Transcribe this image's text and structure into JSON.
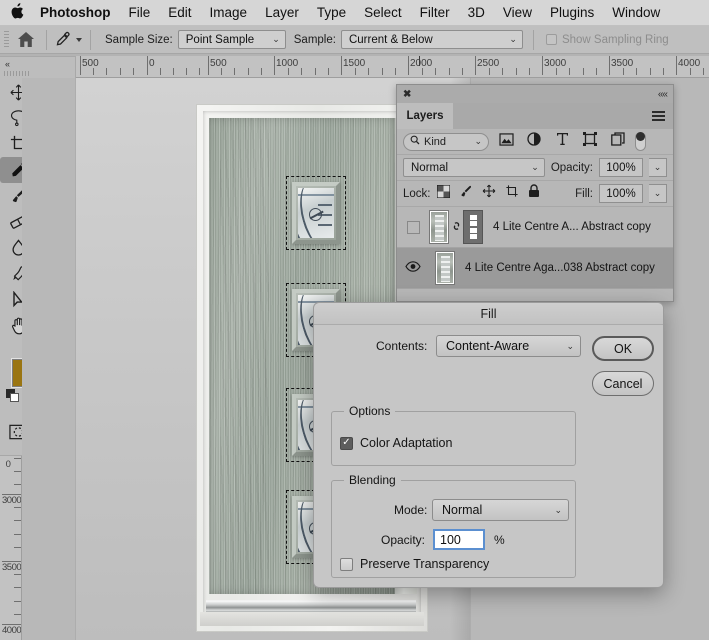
{
  "menubar": {
    "apple_icon": "apple-logo-icon",
    "items": [
      {
        "label": "Photoshop",
        "bold": true
      },
      {
        "label": "File"
      },
      {
        "label": "Edit"
      },
      {
        "label": "Image"
      },
      {
        "label": "Layer"
      },
      {
        "label": "Type"
      },
      {
        "label": "Select"
      },
      {
        "label": "Filter"
      },
      {
        "label": "3D"
      },
      {
        "label": "View"
      },
      {
        "label": "Plugins"
      },
      {
        "label": "Window"
      }
    ]
  },
  "options_bar": {
    "home_icon": "home-icon",
    "tool_icon": "eyedropper-icon",
    "sample_size_label": "Sample Size:",
    "sample_size_value": "Point Sample",
    "sample_label": "Sample:",
    "sample_value": "Current & Below",
    "show_sampling_ring_label": "Show Sampling Ring",
    "show_sampling_ring_checked": false,
    "show_sampling_ring_enabled": false
  },
  "toolbar": {
    "collapse_icon": "double-chevron-left-icon",
    "tools": [
      {
        "name": "move-tool",
        "icon": "move-icon"
      },
      {
        "name": "rectangular-marquee-tool",
        "icon": "marquee-icon"
      },
      {
        "name": "lasso-tool",
        "icon": "lasso-icon"
      },
      {
        "name": "object-selection-tool",
        "icon": "magic-wand-icon"
      },
      {
        "name": "crop-tool",
        "icon": "crop-icon"
      },
      {
        "name": "frame-tool",
        "icon": "frame-icon"
      },
      {
        "name": "eyedropper-tool",
        "icon": "eyedropper-icon",
        "selected": true
      },
      {
        "name": "healing-brush-tool",
        "icon": "healing-brush-icon"
      },
      {
        "name": "brush-tool",
        "icon": "brush-icon"
      },
      {
        "name": "clone-stamp-tool",
        "icon": "clone-stamp-icon"
      },
      {
        "name": "eraser-tool",
        "icon": "eraser-icon"
      },
      {
        "name": "gradient-tool",
        "icon": "gradient-icon"
      },
      {
        "name": "blur-tool",
        "icon": "blur-drop-icon"
      },
      {
        "name": "dodge-tool",
        "icon": "dodge-icon"
      },
      {
        "name": "pen-tool",
        "icon": "pen-icon"
      },
      {
        "name": "type-tool",
        "icon": "type-t-icon"
      },
      {
        "name": "path-selection-tool",
        "icon": "path-arrow-icon"
      },
      {
        "name": "rectangle-tool",
        "icon": "rectangle-shape-icon"
      },
      {
        "name": "hand-tool",
        "icon": "hand-icon"
      },
      {
        "name": "zoom-tool",
        "icon": "magnifier-icon"
      }
    ],
    "more_tools_icon": "ellipsis-icon",
    "foreground_color": "#9a7512",
    "background_color": "#ffffff",
    "swap_colors_icon": "swap-arrows-icon",
    "default_colors_icon": "default-colors-icon",
    "quick_mask_icon": "quick-mask-icon",
    "screen_mode_icon": "screen-mode-icon"
  },
  "rulers": {
    "unit_hint": "px",
    "top_ticks": [
      "500",
      "0",
      "500",
      "1000",
      "1500",
      "2000",
      "2500",
      "3000",
      "3500",
      "4000"
    ],
    "left_ticks": [
      "0",
      "3000",
      "3500",
      "4000"
    ]
  },
  "layers_panel": {
    "close_icon": "close-icon",
    "collapse_icon": "double-chevron-right-icon",
    "tab_label": "Layers",
    "menu_icon": "panel-menu-icon",
    "filter": {
      "search_icon": "search-icon",
      "kind_label": "Kind",
      "icons": [
        {
          "name": "filter-pixel-icon"
        },
        {
          "name": "filter-adjustment-icon"
        },
        {
          "name": "filter-type-icon"
        },
        {
          "name": "filter-shape-icon"
        },
        {
          "name": "filter-smart-object-icon"
        }
      ],
      "toggle_name": "filter-toggle-switch"
    },
    "blend_mode": "Normal",
    "opacity_label": "Opacity:",
    "opacity_value": "100%",
    "lock_label": "Lock:",
    "lock_icons": [
      {
        "name": "lock-transparent-pixels-icon"
      },
      {
        "name": "lock-image-pixels-icon"
      },
      {
        "name": "lock-position-icon"
      },
      {
        "name": "lock-artboard-nesting-icon"
      },
      {
        "name": "lock-all-icon"
      }
    ],
    "fill_label": "Fill:",
    "fill_value": "100%",
    "layers": [
      {
        "name": "4 Lite Centre A... Abstract copy",
        "visible": false,
        "selected": false,
        "has_mask": true,
        "linked": true
      },
      {
        "name": "4 Lite Centre Aga...038 Abstract copy",
        "visible": true,
        "selected": true,
        "has_mask": false,
        "linked": false
      }
    ]
  },
  "fill_dialog": {
    "title": "Fill",
    "contents_label": "Contents:",
    "contents_value": "Content-Aware",
    "ok_label": "OK",
    "cancel_label": "Cancel",
    "options_group_title": "Options",
    "color_adaptation_label": "Color Adaptation",
    "color_adaptation_checked": true,
    "blending_group_title": "Blending",
    "mode_label": "Mode:",
    "mode_value": "Normal",
    "opacity_label": "Opacity:",
    "opacity_value": "100",
    "percent_symbol": "%",
    "preserve_transparency_label": "Preserve Transparency",
    "preserve_transparency_checked": false
  },
  "canvas": {
    "document_name": "composite-door-document",
    "selection_count": 4,
    "selection_label": "marching-ants-selection"
  },
  "colors": {
    "menubar_bg": "#d6d6d6",
    "panel_bg": "#b7b7b7",
    "dialog_bg": "#c6c6c6",
    "selected_layer_bg": "#9a9a9a",
    "focus_blue": "#5b8fd0",
    "foreground_swatch": "#9a7512"
  }
}
